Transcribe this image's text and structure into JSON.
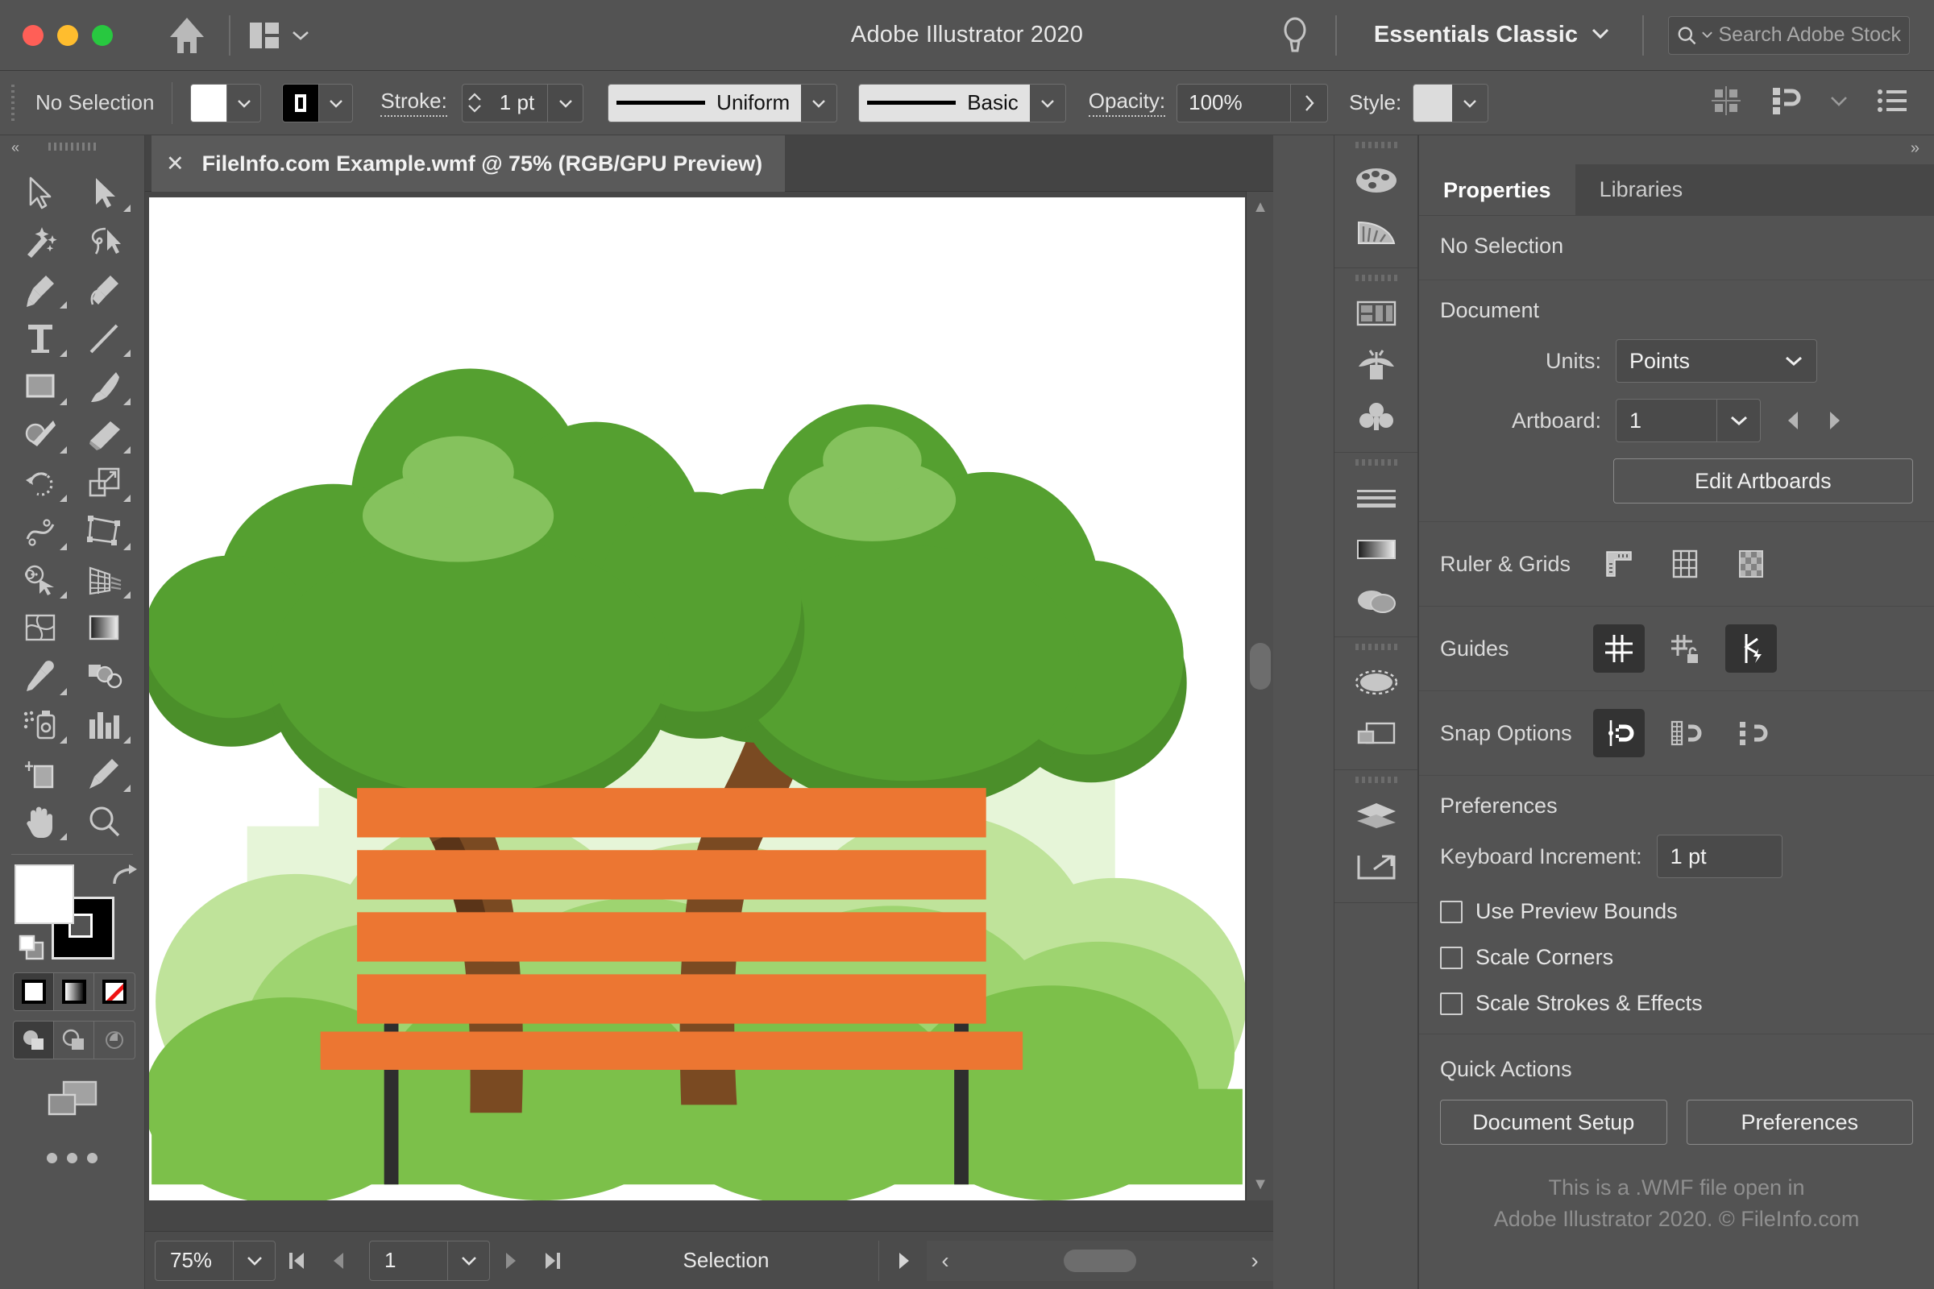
{
  "titlebar": {
    "app_title": "Adobe Illustrator 2020",
    "home_icon": "home-icon",
    "arrange_icon": "arrange-documents-icon",
    "arrange_chevron": "chevron-down-icon",
    "bulb_icon": "discover-bulb-icon",
    "workspace": "Essentials Classic",
    "workspace_chevron": "chevron-down-icon",
    "search_placeholder": "Search Adobe Stock",
    "search_icon": "search-icon",
    "traffic_lights": [
      "close",
      "minimize",
      "zoom"
    ]
  },
  "controlbar": {
    "selection_label": "No Selection",
    "fill_swatch_color": "#ffffff",
    "stroke_swatch_color": "#000000",
    "stroke_label": "Stroke:",
    "stroke_weight": "1 pt",
    "profile_name": "Uniform",
    "brush_name": "Basic",
    "opacity_label": "Opacity:",
    "opacity_value": "100%",
    "style_label": "Style:",
    "style_swatch_color": "#dcdcdc",
    "right_icons": [
      "align-icon",
      "distribute-icon",
      "chevron-down-icon",
      "more-options-icon"
    ]
  },
  "toolbar": {
    "tools": [
      {
        "name": "selection-tool",
        "corner": false
      },
      {
        "name": "direct-selection-tool",
        "corner": true
      },
      {
        "name": "magic-wand-tool",
        "corner": false
      },
      {
        "name": "lasso-tool",
        "corner": false
      },
      {
        "name": "pen-tool",
        "corner": true
      },
      {
        "name": "curvature-tool",
        "corner": false
      },
      {
        "name": "type-tool",
        "corner": true
      },
      {
        "name": "line-segment-tool",
        "corner": true
      },
      {
        "name": "rectangle-tool",
        "corner": true
      },
      {
        "name": "paintbrush-tool",
        "corner": true
      },
      {
        "name": "shaper-tool",
        "corner": true
      },
      {
        "name": "eraser-tool",
        "corner": true
      },
      {
        "name": "rotate-tool",
        "corner": true
      },
      {
        "name": "scale-tool",
        "corner": true
      },
      {
        "name": "width-tool",
        "corner": true
      },
      {
        "name": "free-transform-tool",
        "corner": true
      },
      {
        "name": "shape-builder-tool",
        "corner": true
      },
      {
        "name": "perspective-grid-tool",
        "corner": true
      },
      {
        "name": "mesh-tool",
        "corner": false
      },
      {
        "name": "gradient-tool",
        "corner": false
      },
      {
        "name": "eyedropper-tool",
        "corner": true
      },
      {
        "name": "blend-tool",
        "corner": false
      },
      {
        "name": "symbol-sprayer-tool",
        "corner": true
      },
      {
        "name": "column-graph-tool",
        "corner": true
      },
      {
        "name": "artboard-tool",
        "corner": false
      },
      {
        "name": "slice-tool",
        "corner": true
      },
      {
        "name": "hand-tool",
        "corner": true
      },
      {
        "name": "zoom-tool",
        "corner": false
      }
    ],
    "fill_color": "#ffffff",
    "stroke_color": "#000000",
    "swap_icon": "swap-fill-stroke-icon",
    "default_icon": "default-fill-stroke-icon",
    "fill_modes": [
      "color-swatch",
      "gradient-swatch",
      "none-swatch"
    ],
    "draw_modes": [
      "draw-normal-icon",
      "draw-behind-icon",
      "draw-inside-icon"
    ],
    "screen_mode_icon": "change-screen-mode-icon",
    "more_icon": "edit-toolbar-icon"
  },
  "document": {
    "tab_close_icon": "close-icon",
    "tab_title": "FileInfo.com Example.wmf @ 75% (RGB/GPU Preview)"
  },
  "statusbar": {
    "zoom_level": "75%",
    "zoom_chevron": "chevron-down-icon",
    "first_icon": "first-artboard-icon",
    "prev_icon": "previous-artboard-icon",
    "artboard_number": "1",
    "artboard_chevron": "chevron-down-icon",
    "next_icon": "next-artboard-icon",
    "last_icon": "last-artboard-icon",
    "status_text": "Selection",
    "status_play_icon": "status-menu-icon",
    "scroll_left_icon": "scroll-left-icon",
    "scroll_right_icon": "scroll-right-icon"
  },
  "dock": {
    "groups": [
      [
        "color-palette-icon",
        "color-guide-icon"
      ],
      [
        "libraries-icon",
        "brushes-icon",
        "symbols-icon"
      ],
      [
        "stroke-icon",
        "gradient-icon",
        "transparency-icon"
      ],
      [
        "appearance-icon",
        "pathfinder-icon"
      ],
      [
        "layers-icon",
        "artboards-icon"
      ]
    ]
  },
  "panel": {
    "collapse_icon": "collapse-panels-icon",
    "tabs": [
      {
        "label": "Properties",
        "active": true
      },
      {
        "label": "Libraries",
        "active": false
      }
    ],
    "selection_state": "No Selection",
    "document": {
      "title": "Document",
      "units_label": "Units:",
      "units_value": "Points",
      "units_chevron": "chevron-down-icon",
      "artboard_label": "Artboard:",
      "artboard_value": "1",
      "artboard_chevron": "chevron-down-icon",
      "prev_artboard_icon": "previous-artboard-icon",
      "next_artboard_icon": "next-artboard-icon",
      "edit_artboards_button": "Edit Artboards"
    },
    "ruler_grids": {
      "label": "Ruler & Grids",
      "icons": [
        "show-rulers-icon",
        "show-grid-icon",
        "show-transparency-grid-icon"
      ]
    },
    "guides": {
      "label": "Guides",
      "icons": [
        "show-guides-icon",
        "lock-guides-icon",
        "smart-guides-icon"
      ],
      "active": [
        true,
        false,
        true
      ]
    },
    "snap_options": {
      "label": "Snap Options",
      "icons": [
        "snap-to-point-icon",
        "snap-to-grid-icon",
        "snap-to-pixel-icon"
      ],
      "active": [
        true,
        false,
        false
      ]
    },
    "preferences": {
      "title": "Preferences",
      "keyboard_increment_label": "Keyboard Increment:",
      "keyboard_increment_value": "1 pt",
      "checkboxes": [
        {
          "label": "Use Preview Bounds",
          "checked": false
        },
        {
          "label": "Scale Corners",
          "checked": false
        },
        {
          "label": "Scale Strokes & Effects",
          "checked": false
        }
      ]
    },
    "quick_actions": {
      "title": "Quick Actions",
      "buttons": [
        "Document Setup",
        "Preferences"
      ]
    },
    "watermark_line1": "This is a .WMF file open in",
    "watermark_line2": "Adobe Illustrator 2020. © FileInfo.com"
  },
  "artwork": {
    "description": "Flat illustration of a park: two broad-canopy green trees with brown trunks, a pale-green city skyline silhouette, layered green bushes and an orange wooden park bench with dark legs.",
    "colors": {
      "background": "#ffffff",
      "skyline": "#e6f5d8",
      "canopy_main": "#55a030",
      "canopy_shadow": "#4b8f2a",
      "canopy_highlight": "#85c25d",
      "trunk": "#7a4a22",
      "trunk_dark": "#5a3418",
      "bush_light": "#bfe39a",
      "bush_mid": "#9ed470",
      "bush_dark": "#7cc04a",
      "bench_wood": "#ec7632",
      "bench_leg": "#2e2e2e"
    }
  }
}
